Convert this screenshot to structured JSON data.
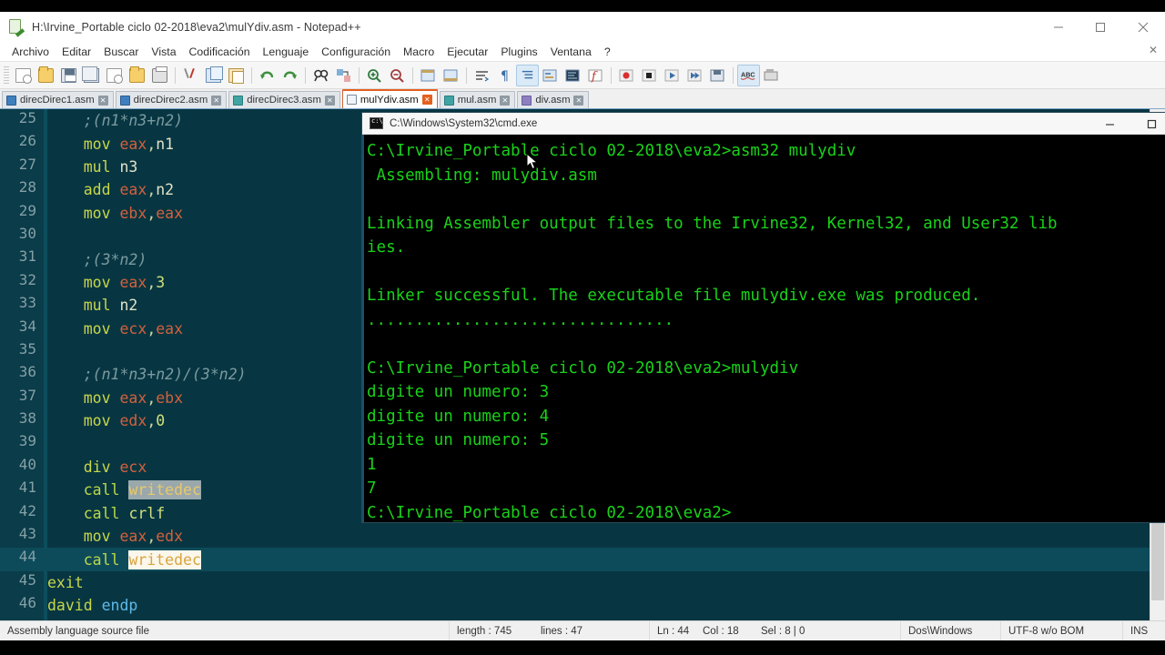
{
  "window": {
    "title": "H:\\Irvine_Portable ciclo 02-2018\\eva2\\mulYdiv.asm - Notepad++",
    "minimize_label": "—",
    "maximize_label": "❐",
    "close_label": "✕"
  },
  "menu": {
    "items": [
      "Archivo",
      "Editar",
      "Buscar",
      "Vista",
      "Codificación",
      "Lenguaje",
      "Configuración",
      "Macro",
      "Ejecutar",
      "Plugins",
      "Ventana",
      "?"
    ],
    "doc_close": "✕"
  },
  "toolbar": {
    "buttons": [
      {
        "name": "new-file-icon",
        "glyph": "□"
      },
      {
        "name": "open-file-icon",
        "glyph": "□"
      },
      {
        "name": "save-icon",
        "glyph": "□"
      },
      {
        "name": "save-all-icon",
        "glyph": "□"
      },
      {
        "name": "close-file-icon",
        "glyph": "□"
      },
      {
        "name": "close-all-icon",
        "glyph": "□"
      },
      {
        "name": "print-icon",
        "glyph": "□"
      },
      {
        "name": "cut-icon",
        "glyph": "✂"
      },
      {
        "name": "copy-icon",
        "glyph": "⧉"
      },
      {
        "name": "paste-icon",
        "glyph": "▤"
      },
      {
        "name": "undo-icon",
        "glyph": "↶"
      },
      {
        "name": "redo-icon",
        "glyph": "↷"
      },
      {
        "name": "find-icon",
        "glyph": "🔍"
      },
      {
        "name": "replace-icon",
        "glyph": "⇄"
      },
      {
        "name": "zoom-in-icon",
        "glyph": "⊕"
      },
      {
        "name": "zoom-out-icon",
        "glyph": "⊖"
      },
      {
        "name": "sync-scroll-v-icon",
        "glyph": "▣"
      },
      {
        "name": "sync-scroll-h-icon",
        "glyph": "▣"
      },
      {
        "name": "word-wrap-icon",
        "glyph": "≡"
      },
      {
        "name": "show-all-chars-icon",
        "glyph": "¶"
      },
      {
        "name": "indent-guide-icon",
        "glyph": "≣"
      },
      {
        "name": "user-defined-dialog-icon",
        "glyph": "▧"
      },
      {
        "name": "doc-map-icon",
        "glyph": "▦"
      },
      {
        "name": "function-list-icon",
        "glyph": "ƒ"
      },
      {
        "name": "record-macro-icon",
        "glyph": "●"
      },
      {
        "name": "stop-macro-icon",
        "glyph": "■"
      },
      {
        "name": "play-macro-icon",
        "glyph": "▶"
      },
      {
        "name": "play-macro-multiple-icon",
        "glyph": "▶▶"
      },
      {
        "name": "save-macro-icon",
        "glyph": "▥"
      },
      {
        "name": "spellcheck-icon",
        "glyph": "ABC"
      },
      {
        "name": "run-icon",
        "glyph": "▤"
      }
    ]
  },
  "tabs": [
    {
      "label": "direcDirec1.asm",
      "active": false,
      "icon": "blue-doc-icon"
    },
    {
      "label": "direcDirec2.asm",
      "active": false,
      "icon": "blue-doc-icon"
    },
    {
      "label": "direcDirec3.asm",
      "active": false,
      "icon": "teal-doc-icon"
    },
    {
      "label": "mulYdiv.asm",
      "active": true,
      "icon": "saved-doc-icon"
    },
    {
      "label": "mul.asm",
      "active": false,
      "icon": "teal-doc-icon"
    },
    {
      "label": "div.asm",
      "active": false,
      "icon": "violet-doc-icon"
    }
  ],
  "editor": {
    "first_visible_line": 25,
    "current_line": 44,
    "lines": [
      {
        "n": 25,
        "tokens": [
          {
            "t": "    ",
            "c": "t-plain"
          },
          {
            "t": ";(n1*n3+n2)",
            "c": "t-comment"
          }
        ]
      },
      {
        "n": 26,
        "tokens": [
          {
            "t": "    ",
            "c": "t-plain"
          },
          {
            "t": "mov",
            "c": "t-op"
          },
          {
            "t": " ",
            "c": "t-plain"
          },
          {
            "t": "eax",
            "c": "t-reg"
          },
          {
            "t": ",",
            "c": "t-punct"
          },
          {
            "t": "n1",
            "c": "t-id"
          }
        ]
      },
      {
        "n": 27,
        "tokens": [
          {
            "t": "    ",
            "c": "t-plain"
          },
          {
            "t": "mul",
            "c": "t-op"
          },
          {
            "t": " ",
            "c": "t-plain"
          },
          {
            "t": "n3",
            "c": "t-id"
          }
        ]
      },
      {
        "n": 28,
        "tokens": [
          {
            "t": "    ",
            "c": "t-plain"
          },
          {
            "t": "add",
            "c": "t-op"
          },
          {
            "t": " ",
            "c": "t-plain"
          },
          {
            "t": "eax",
            "c": "t-reg"
          },
          {
            "t": ",",
            "c": "t-punct"
          },
          {
            "t": "n2",
            "c": "t-id"
          }
        ]
      },
      {
        "n": 29,
        "tokens": [
          {
            "t": "    ",
            "c": "t-plain"
          },
          {
            "t": "mov",
            "c": "t-op"
          },
          {
            "t": " ",
            "c": "t-plain"
          },
          {
            "t": "ebx",
            "c": "t-reg"
          },
          {
            "t": ",",
            "c": "t-punct"
          },
          {
            "t": "eax",
            "c": "t-reg"
          }
        ]
      },
      {
        "n": 30,
        "tokens": []
      },
      {
        "n": 31,
        "tokens": [
          {
            "t": "    ",
            "c": "t-plain"
          },
          {
            "t": ";(3*n2)",
            "c": "t-comment"
          }
        ]
      },
      {
        "n": 32,
        "tokens": [
          {
            "t": "    ",
            "c": "t-plain"
          },
          {
            "t": "mov",
            "c": "t-op"
          },
          {
            "t": " ",
            "c": "t-plain"
          },
          {
            "t": "eax",
            "c": "t-reg"
          },
          {
            "t": ",",
            "c": "t-punct"
          },
          {
            "t": "3",
            "c": "t-num"
          }
        ]
      },
      {
        "n": 33,
        "tokens": [
          {
            "t": "    ",
            "c": "t-plain"
          },
          {
            "t": "mul",
            "c": "t-op"
          },
          {
            "t": " ",
            "c": "t-plain"
          },
          {
            "t": "n2",
            "c": "t-id"
          }
        ]
      },
      {
        "n": 34,
        "tokens": [
          {
            "t": "    ",
            "c": "t-plain"
          },
          {
            "t": "mov",
            "c": "t-op"
          },
          {
            "t": " ",
            "c": "t-plain"
          },
          {
            "t": "ecx",
            "c": "t-reg"
          },
          {
            "t": ",",
            "c": "t-punct"
          },
          {
            "t": "eax",
            "c": "t-reg"
          }
        ]
      },
      {
        "n": 35,
        "tokens": []
      },
      {
        "n": 36,
        "tokens": [
          {
            "t": "    ",
            "c": "t-plain"
          },
          {
            "t": ";(n1*n3+n2)/(3*n2)",
            "c": "t-comment"
          }
        ]
      },
      {
        "n": 37,
        "tokens": [
          {
            "t": "    ",
            "c": "t-plain"
          },
          {
            "t": "mov",
            "c": "t-op"
          },
          {
            "t": " ",
            "c": "t-plain"
          },
          {
            "t": "eax",
            "c": "t-reg"
          },
          {
            "t": ",",
            "c": "t-punct"
          },
          {
            "t": "ebx",
            "c": "t-reg"
          }
        ]
      },
      {
        "n": 38,
        "tokens": [
          {
            "t": "    ",
            "c": "t-plain"
          },
          {
            "t": "mov",
            "c": "t-op"
          },
          {
            "t": " ",
            "c": "t-plain"
          },
          {
            "t": "edx",
            "c": "t-reg"
          },
          {
            "t": ",",
            "c": "t-punct"
          },
          {
            "t": "0",
            "c": "t-num"
          }
        ]
      },
      {
        "n": 39,
        "tokens": []
      },
      {
        "n": 40,
        "tokens": [
          {
            "t": "    ",
            "c": "t-plain"
          },
          {
            "t": "div",
            "c": "t-op"
          },
          {
            "t": " ",
            "c": "t-plain"
          },
          {
            "t": "ecx",
            "c": "t-reg"
          }
        ]
      },
      {
        "n": 41,
        "tokens": [
          {
            "t": "    ",
            "c": "t-plain"
          },
          {
            "t": "call",
            "c": "t-call"
          },
          {
            "t": " ",
            "c": "t-plain"
          },
          {
            "t": "writedec",
            "c": "hl-dim"
          }
        ]
      },
      {
        "n": 42,
        "tokens": [
          {
            "t": "    ",
            "c": "t-plain"
          },
          {
            "t": "call",
            "c": "t-call"
          },
          {
            "t": " ",
            "c": "t-plain"
          },
          {
            "t": "crlf",
            "c": "t-num"
          }
        ]
      },
      {
        "n": 43,
        "tokens": [
          {
            "t": "    ",
            "c": "t-plain"
          },
          {
            "t": "mov",
            "c": "t-op"
          },
          {
            "t": " ",
            "c": "t-plain"
          },
          {
            "t": "eax",
            "c": "t-reg"
          },
          {
            "t": ",",
            "c": "t-punct"
          },
          {
            "t": "edx",
            "c": "t-reg"
          }
        ]
      },
      {
        "n": 44,
        "tokens": [
          {
            "t": "    ",
            "c": "t-plain"
          },
          {
            "t": "call",
            "c": "t-call"
          },
          {
            "t": " ",
            "c": "t-plain"
          },
          {
            "t": "writedec",
            "c": "hl-sel"
          }
        ]
      },
      {
        "n": 45,
        "tokens": [
          {
            "t": "exit",
            "c": "t-op"
          }
        ]
      },
      {
        "n": 46,
        "tokens": [
          {
            "t": "david",
            "c": "t-op"
          },
          {
            "t": " ",
            "c": "t-plain"
          },
          {
            "t": "endp",
            "c": "t-kw"
          }
        ]
      }
    ]
  },
  "console": {
    "title": "C:\\Windows\\System32\\cmd.exe",
    "minimize_label": "—",
    "maximize_label": "❐",
    "lines": [
      "C:\\Irvine_Portable ciclo 02-2018\\eva2>asm32 mulydiv",
      " Assembling: mulydiv.asm",
      "",
      "Linking Assembler output files to the Irvine32, Kernel32, and User32 libraries.",
      "ies.",
      "",
      "Linker successful. The executable file mulydiv.exe was produced.",
      "................................",
      "",
      "C:\\Irvine_Portable ciclo 02-2018\\eva2>mulydiv",
      "digite un numero: 3",
      "digite un numero: 4",
      "digite un numero: 5",
      "1",
      "7",
      "C:\\Irvine_Portable ciclo 02-2018\\eva2>"
    ],
    "rendered_lines": [
      "C:\\Irvine_Portable ciclo 02-2018\\eva2>asm32 mulydiv",
      " Assembling: mulydiv.asm",
      "",
      "Linking Assembler output files to the Irvine32, Kernel32, and User32 lib",
      "ies.",
      "",
      "Linker successful. The executable file mulydiv.exe was produced.",
      "................................",
      "",
      "C:\\Irvine_Portable ciclo 02-2018\\eva2>mulydiv",
      "digite un numero: 3",
      "digite un numero: 4",
      "digite un numero: 5",
      "1",
      "7",
      "C:\\Irvine_Portable ciclo 02-2018\\eva2>"
    ],
    "text_color": "#19d219",
    "background": "#000000"
  },
  "statusbar": {
    "doc_type": "Assembly language source file",
    "length": "length : 745",
    "lines": "lines : 47",
    "ln": "Ln : 44",
    "col": "Col : 18",
    "sel": "Sel : 8 | 0",
    "eol": "Dos\\Windows",
    "encoding": "UTF-8 w/o BOM",
    "insert_mode": "INS"
  },
  "colors": {
    "editor_bg": "#073642",
    "editor_gutter": "#0a3c49",
    "current_line": "#0e4b5a",
    "accent_tab": "#e3601e",
    "console_green": "#19d219"
  }
}
